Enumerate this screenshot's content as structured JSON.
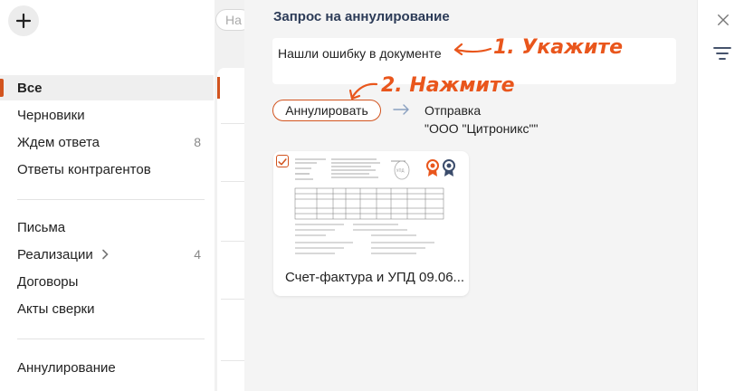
{
  "sidebar": {
    "items": [
      {
        "label": "Все",
        "count": ""
      },
      {
        "label": "Черновики",
        "count": ""
      },
      {
        "label": "Ждем ответа",
        "count": "8"
      },
      {
        "label": "Ответы контрагентов",
        "count": ""
      },
      {
        "label": "Письма",
        "count": ""
      },
      {
        "label": "Реализации",
        "count": "4"
      },
      {
        "label": "Договоры",
        "count": ""
      },
      {
        "label": "Акты сверки",
        "count": ""
      },
      {
        "label": "Аннулирование",
        "count": ""
      }
    ]
  },
  "search": {
    "placeholder": "На"
  },
  "panel": {
    "title": "Запрос на аннулирование",
    "reason_text": "Нашли ошибку в документе",
    "annul_button": "Аннулировать",
    "send_label": "Отправка",
    "send_recipient": "\"ООО \"Цитроникс\"\"",
    "document": {
      "title": "Счет-фактура и УПД 09.06..."
    }
  },
  "annotations": {
    "step1": "1. Укажите",
    "step2": "2. Нажмите"
  },
  "colors": {
    "accent": "#d2541f",
    "annotation": "#e9561c",
    "title": "#2c3b57"
  }
}
